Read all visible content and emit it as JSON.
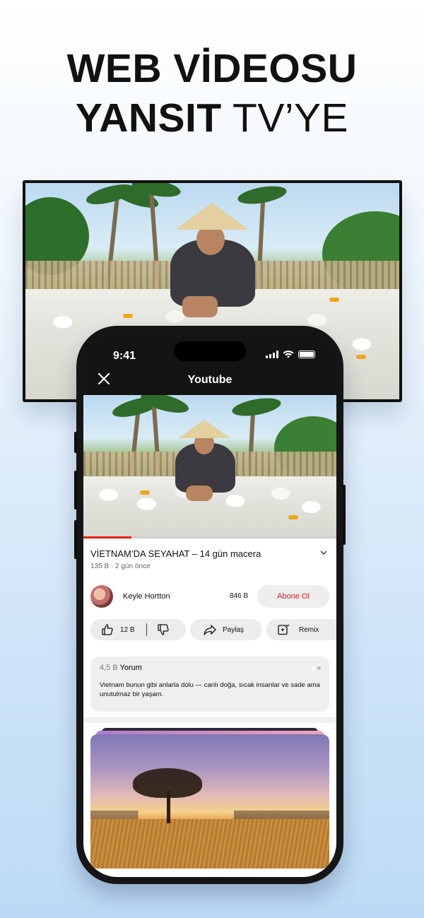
{
  "headline": {
    "line1": "WEB VİDEOSU",
    "line2_bold": "YANSIT",
    "line2_normal": "TV’YE"
  },
  "status_bar": {
    "time": "9:41"
  },
  "nav": {
    "title": "Youtube"
  },
  "video": {
    "title": "VİETNAM’DA SEYAHAT – 14 gün macera",
    "meta": "135 B · 2 gün önce",
    "progress": 0.19
  },
  "channel": {
    "name": "Keyle Hortton",
    "subscribers": "846 B",
    "subscribe_label": "Abone Ol"
  },
  "actions": {
    "likes": "12 B",
    "share_label": "Paylaş",
    "remix_label": "Remix"
  },
  "comments": {
    "count": "4,5 B",
    "label": "Yorum",
    "text": "Vietnam bunun gibi anlarla dolu — canlı doğa, sıcak insanlar ve sade ama unutulmaz bir yaşam."
  },
  "icons": {
    "close": "close-icon",
    "chevron": "chevron-down-icon",
    "like": "thumbs-up-icon",
    "dislike": "thumbs-down-icon",
    "share": "share-icon",
    "remix": "remix-icon"
  },
  "colors": {
    "accent_red": "#e62117",
    "subscribe_text": "#e0202a"
  }
}
